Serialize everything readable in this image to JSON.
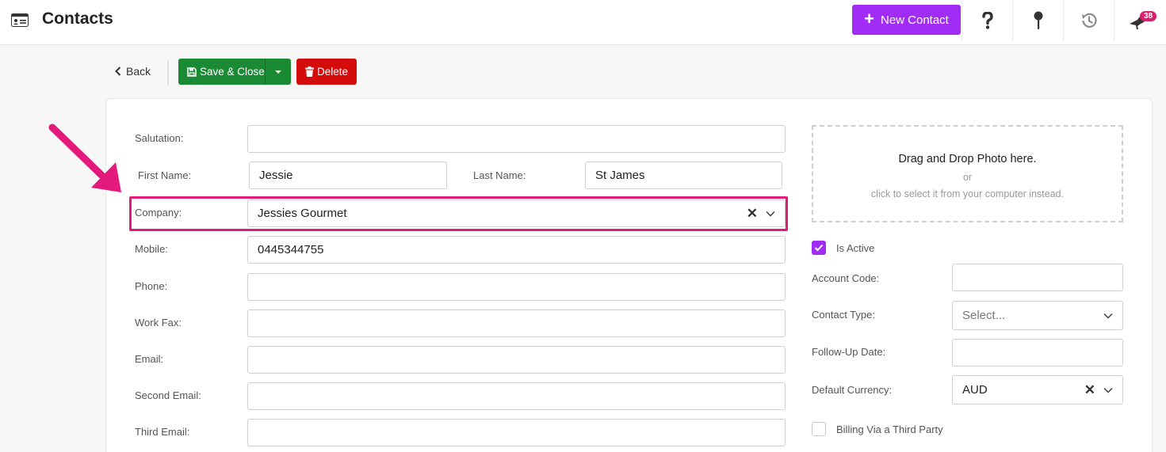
{
  "header": {
    "title": "Contacts",
    "new_button": "New Contact",
    "notification_count": "38",
    "icons": [
      "contact-card-icon",
      "help-icon",
      "pin-icon",
      "history-icon",
      "bird-icon"
    ]
  },
  "toolbar": {
    "back": "Back",
    "save_close": "Save & Close",
    "delete": "Delete"
  },
  "form": {
    "salutation": {
      "label": "Salutation:",
      "value": ""
    },
    "first_name": {
      "label": "First Name:",
      "value": "Jessie"
    },
    "last_name": {
      "label": "Last Name:",
      "value": "St James"
    },
    "company": {
      "label": "Company:",
      "value": "Jessies Gourmet"
    },
    "mobile": {
      "label": "Mobile:",
      "value": "0445344755"
    },
    "phone": {
      "label": "Phone:",
      "value": ""
    },
    "work_fax": {
      "label": "Work Fax:",
      "value": ""
    },
    "email": {
      "label": "Email:",
      "value": ""
    },
    "second_email": {
      "label": "Second Email:",
      "value": ""
    },
    "third_email": {
      "label": "Third Email:",
      "value": ""
    }
  },
  "photo": {
    "title": "Drag and Drop Photo here.",
    "or": "or",
    "sub": "click to select it from your computer instead."
  },
  "side": {
    "is_active": {
      "label": "Is Active",
      "checked": true
    },
    "account_code": {
      "label": "Account Code:",
      "value": ""
    },
    "contact_type": {
      "label": "Contact Type:",
      "placeholder": "Select..."
    },
    "follow_up": {
      "label": "Follow-Up Date:",
      "value": ""
    },
    "currency": {
      "label": "Default Currency:",
      "value": "AUD"
    },
    "billing": {
      "label": "Billing Via a Third Party",
      "checked": false
    }
  },
  "colors": {
    "accent": "#a12cf5",
    "save": "#1a8a34",
    "delete": "#d50c0c",
    "annotation": "#e3197b",
    "badge": "#d6226e"
  }
}
